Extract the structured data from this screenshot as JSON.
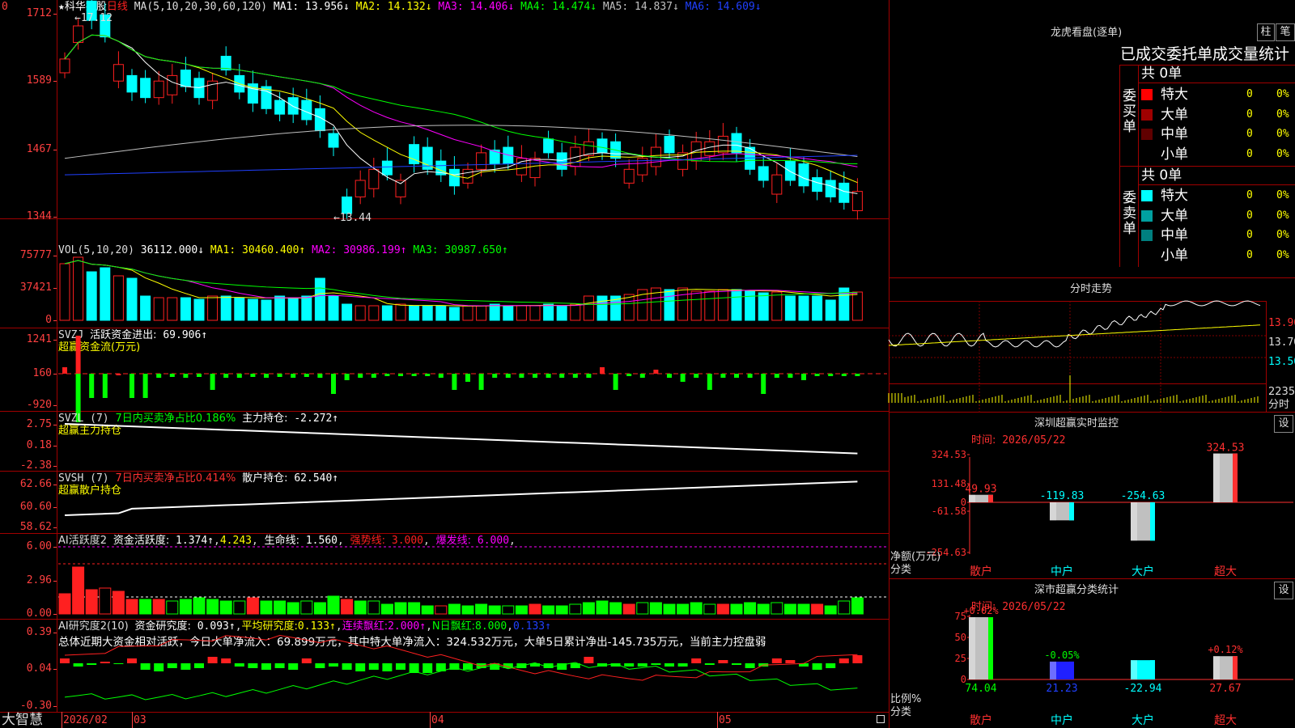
{
  "main_chart": {
    "title_star": "★",
    "stock_name": "科华控股",
    "period": "日线",
    "ma_params": "MA(5,10,20,30,60,120)",
    "ma_values": [
      {
        "label": "MA1:",
        "value": "13.956↓",
        "color": "#ffffff"
      },
      {
        "label": "MA2:",
        "value": "14.132↓",
        "color": "#ffff00"
      },
      {
        "label": "MA3:",
        "value": "14.406↓",
        "color": "#ff00ff"
      },
      {
        "label": "MA4:",
        "value": "14.474↓",
        "color": "#00ff00"
      },
      {
        "label": "MA5:",
        "value": "14.837↓",
        "color": "#c0c0c0"
      },
      {
        "label": "MA6:",
        "value": "14.609↓",
        "color": "#2040ff"
      }
    ],
    "y_labels": [
      "1712",
      "1589",
      "1467",
      "1344"
    ],
    "high_mark": "17.12",
    "low_mark": "13.44",
    "axis_marker": "0"
  },
  "vol_panel": {
    "label": "VOL(5,10,20)",
    "value": "36112.000↓",
    "ma": [
      {
        "label": "MA1:",
        "value": "30460.400↑",
        "color": "#ffff00"
      },
      {
        "label": "MA2:",
        "value": "30986.199↑",
        "color": "#ff00ff"
      },
      {
        "label": "MA3:",
        "value": "30987.650↑",
        "color": "#00ff00"
      }
    ],
    "y_labels": [
      "75777",
      "37421",
      "0"
    ]
  },
  "svzj_panel": {
    "label": "SVZJ",
    "desc": "活跃资金进出:",
    "value": "69.906↑",
    "sub": "超赢资金流(万元)",
    "y_labels": [
      "1241",
      "160",
      "-920"
    ]
  },
  "svzl_panel": {
    "label": "SVZL (7)",
    "ratio_text": "7日内买卖净占比0.186%",
    "hold_label": "主力持仓:",
    "hold_value": "-2.272↑",
    "sub": "超赢主力持仓",
    "y_labels": [
      "2.75",
      "0.18",
      "-2.38"
    ]
  },
  "svsh_panel": {
    "label": "SVSH (7)",
    "ratio_text": "7日内买卖净占比0.414%",
    "hold_label": "散户持仓:",
    "hold_value": "62.540↑",
    "sub": "超赢散户持仓",
    "y_labels": [
      "62.66",
      "60.60",
      "58.62"
    ]
  },
  "ai_active_panel": {
    "label": "AI活跃度2",
    "act_label": "资金活跃度:",
    "act_value": "1.374↑",
    "act_value2": "4.243",
    "life_label": "生命线:",
    "life_value": "1.560",
    "strong_label": "强势线:",
    "strong_value": "3.000",
    "burst_label": "爆发线:",
    "burst_value": "6.000",
    "y_labels": [
      "6.00",
      "2.96",
      "0.00"
    ]
  },
  "ai_research_panel": {
    "label": "AI研究度2(10)",
    "res_label": "资金研究度:",
    "res_value": "0.093↑",
    "avg_label": "平均研究度:",
    "avg_value": "0.133↑",
    "red_label": "连续飘红:",
    "red_value": "2.000↑",
    "nred_label": "N日飘红:",
    "nred_value": "8.000",
    "last_value": "0.133↑",
    "summary": "总体近期大资金相对活跃，今日大单净流入：69.899万元，其中特大单净流入：324.532万元，大单5日累计净出-145.735万元，当前主力控盘弱",
    "y_labels": [
      "0.39",
      "0.04",
      "-0.30"
    ]
  },
  "bottom_axis": {
    "brand": "大智慧",
    "labels": [
      "2026/02",
      "03",
      "04",
      "05"
    ]
  },
  "dragon_tiger": {
    "title": "龙虎看盘(逐单)",
    "btn1": "柱",
    "btn2": "笔",
    "subtitle": "已成交委托单成交量统计",
    "buy_side": "委买单",
    "sell_side": "委卖单",
    "buy_total": "共 0单",
    "sell_total": "共 0单",
    "buy_rows": [
      {
        "name": "特大",
        "color": "#ff0000",
        "count": "0",
        "pct": "0%"
      },
      {
        "name": "大单",
        "color": "#a00000",
        "count": "0",
        "pct": "0%"
      },
      {
        "name": "中单",
        "color": "#600000",
        "count": "0",
        "pct": "0%"
      },
      {
        "name": "小单",
        "color": "#000000",
        "count": "0",
        "pct": "0%"
      }
    ],
    "sell_rows": [
      {
        "name": "特大",
        "color": "#00ffff",
        "count": "0",
        "pct": "0%"
      },
      {
        "name": "大单",
        "color": "#00a0a0",
        "count": "0",
        "pct": "0%"
      },
      {
        "name": "中单",
        "color": "#008080",
        "count": "0",
        "pct": "0%"
      },
      {
        "name": "小单",
        "color": "#000000",
        "count": "0",
        "pct": "0%"
      }
    ]
  },
  "intraday": {
    "title": "分时走势",
    "price_labels": [
      "13.90",
      "13.70",
      "13.50"
    ],
    "vol_labels": [
      "2235",
      "分时"
    ]
  },
  "sz_monitor": {
    "title": "深圳超赢实时监控",
    "btn": "设",
    "time_label": "时间:",
    "time_value": "2026/05/22",
    "y_labels": [
      "324.53",
      "131.48",
      "0",
      "-61.58",
      "-254.63"
    ],
    "unit_label": "净额(万元)",
    "cat_label": "分类",
    "chart_data": {
      "type": "bar",
      "categories": [
        "散户",
        "中户",
        "大户",
        "超大"
      ],
      "values": [
        49.93,
        -119.83,
        -254.63,
        324.53
      ],
      "value_labels": [
        "49.93",
        "-119.83",
        "-254.63",
        "324.53"
      ],
      "ylim": [
        -254.63,
        324.53
      ]
    }
  },
  "sz_class": {
    "title": "深市超赢分类统计",
    "btn": "设",
    "time_label": "时间:",
    "time_value": "2026/05/22",
    "y_labels": [
      "75",
      "50",
      "25",
      "0"
    ],
    "ratio_label": "比例%",
    "cat_label": "分类",
    "chart_data": {
      "type": "bar",
      "categories": [
        "散户",
        "中户",
        "大户",
        "超大"
      ],
      "values": [
        74.04,
        21.23,
        -22.94,
        27.67
      ],
      "value_labels": [
        "74.04",
        "21.23",
        "-22.94",
        "27.67"
      ],
      "change_labels": [
        "+0.02%",
        "-0.05%",
        "",
        "+0.12%"
      ],
      "ylim": [
        0,
        75
      ]
    }
  }
}
